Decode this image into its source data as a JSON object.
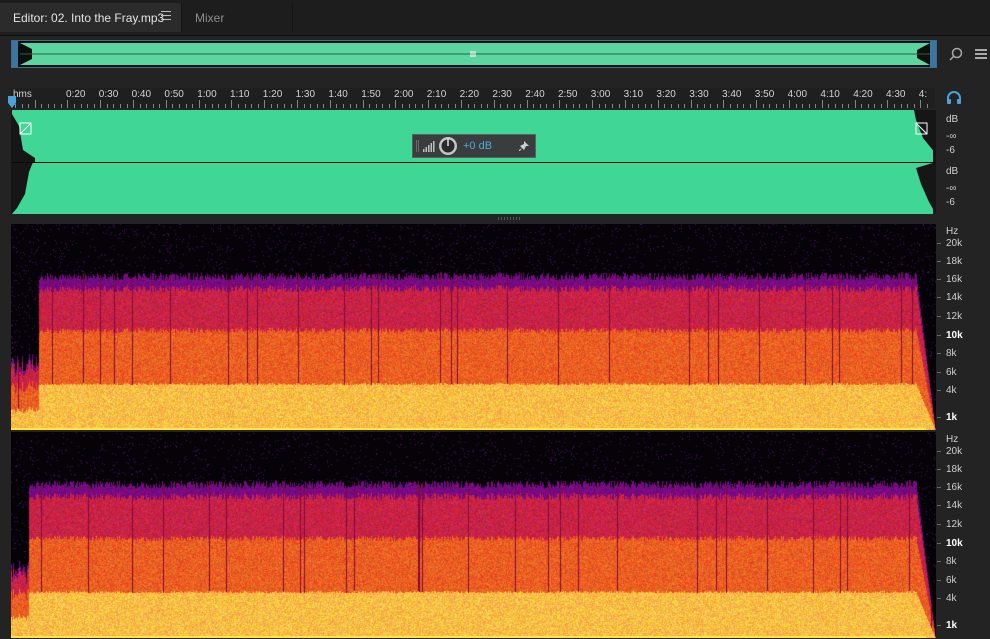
{
  "tabs": {
    "editor_label": "Editor: 02. Into the Fray.mp3",
    "mixer_label": "Mixer"
  },
  "ruler": {
    "unit": "hms",
    "labels": [
      "0:20",
      "0:30",
      "0:40",
      "0:50",
      "1:00",
      "1:10",
      "1:20",
      "1:30",
      "1:40",
      "1:50",
      "2:00",
      "2:10",
      "2:20",
      "2:30",
      "2:40",
      "2:50",
      "3:00",
      "3:10",
      "3:20",
      "3:30",
      "3:40",
      "3:50",
      "4:00",
      "4:10",
      "4:20",
      "4:30",
      "4:"
    ]
  },
  "waveform": {
    "channels": [
      {
        "unit": "dB",
        "minus_inf": "-∞",
        "minus6": "-6"
      },
      {
        "unit": "dB",
        "minus_inf": "-∞",
        "minus6": "-6"
      }
    ],
    "hud_gain": "+0 dB"
  },
  "spectral": {
    "unit": "Hz",
    "labels": [
      "20k",
      "18k",
      "16k",
      "14k",
      "12k",
      "10k",
      "8k",
      "6k",
      "4k",
      "1k"
    ]
  },
  "colors": {
    "waveform": "#3fd696",
    "accent": "#4aa3d8",
    "background": "#232323"
  }
}
